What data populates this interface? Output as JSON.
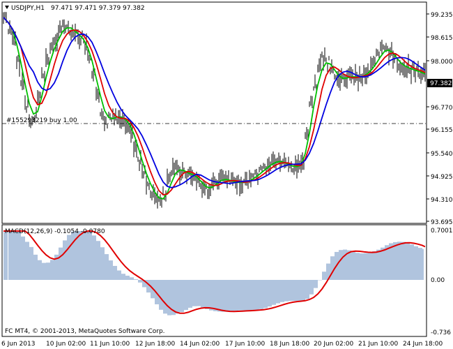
{
  "header": {
    "symbol": "USDJPY,H1",
    "ohlc": "97.471 97.471 97.379 97.382"
  },
  "colors": {
    "background": "#ffffff",
    "bars": "#000000",
    "ma_fast": "#00c000",
    "ma_mid": "#e00000",
    "ma_slow": "#0000e0",
    "macd_hist": "#b0c4de",
    "macd_signal": "#e00000",
    "price_tag_bg": "#000000",
    "price_tag_text": "#ffffff"
  },
  "price_axis": {
    "labels": [
      "99.235",
      "98.615",
      "98.000",
      "97.382",
      "96.770",
      "96.155",
      "95.540",
      "94.925",
      "94.310",
      "93.695"
    ],
    "current_price": "97.382"
  },
  "order_line": {
    "label": "#155293219 buy 1.00",
    "price": 96.38
  },
  "macd": {
    "title": "MACD(12,26,9) -0.1054 -0.0780",
    "axis_labels": [
      "0.7001",
      "0.00",
      "-0.736"
    ]
  },
  "time_axis": {
    "labels": [
      "6 Jun 2013",
      "10 Jun 02:00",
      "11 Jun 10:00",
      "12 Jun 18:00",
      "14 Jun 02:00",
      "17 Jun 10:00",
      "18 Jun 18:00",
      "20 Jun 02:00",
      "21 Jun 10:00",
      "24 Jun 18:00"
    ]
  },
  "footer": {
    "copyright": "FC MT4, © 2001-2013, MetaQuotes Software Corp."
  },
  "icons": {
    "header_arrow": "triangle-down-icon"
  }
}
